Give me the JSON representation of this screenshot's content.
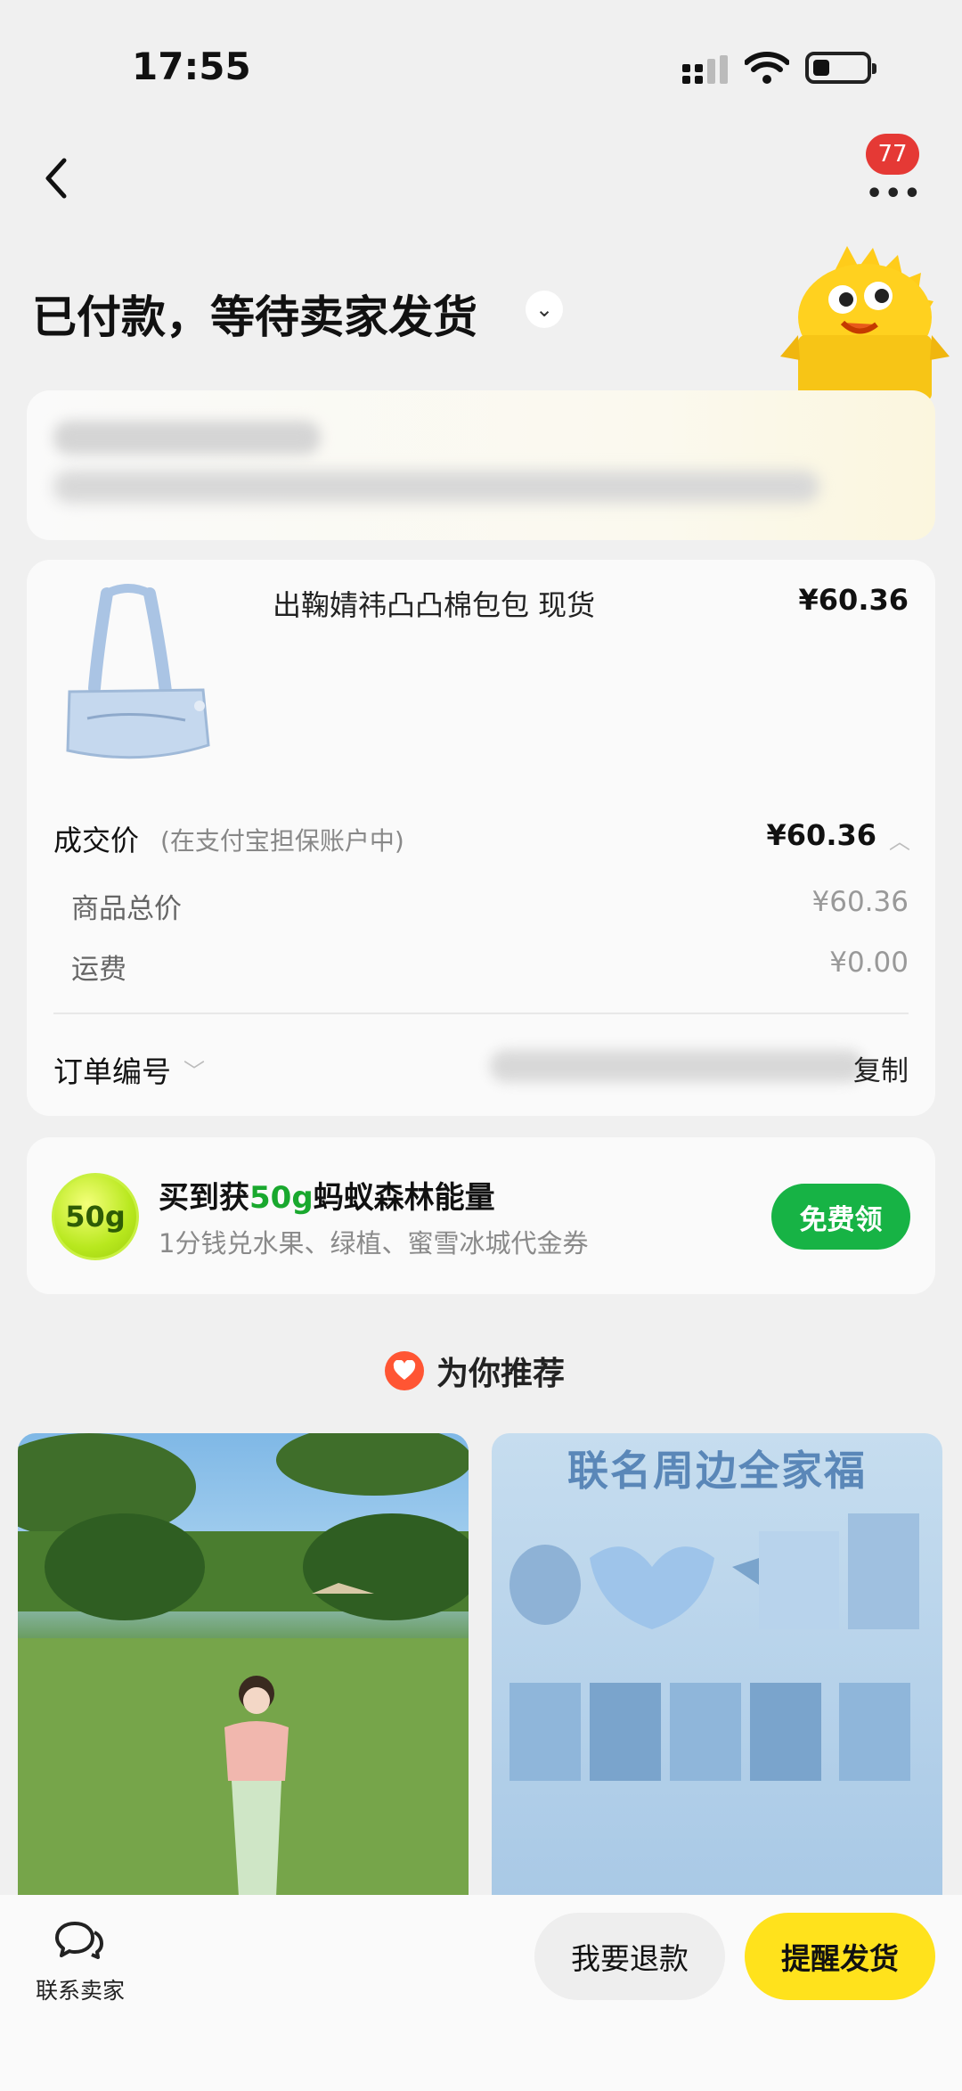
{
  "status_bar": {
    "time": "17:55"
  },
  "header": {
    "notification_count": "77",
    "title": "已付款，等待卖家发货"
  },
  "product": {
    "name": "出鞠婧祎凸凸棉包包 现货",
    "price": "¥60.36"
  },
  "price_detail": {
    "deal_label": "成交价",
    "deal_note": "(在支付宝担保账户中)",
    "deal_price": "¥60.36",
    "rows": [
      {
        "label": "商品总价",
        "value": "¥60.36"
      },
      {
        "label": "运费",
        "value": "¥0.00"
      }
    ]
  },
  "order_number": {
    "label": "订单编号",
    "copy_label": "复制"
  },
  "energy": {
    "badge": "50g",
    "title_prefix": "买到获",
    "title_amount": "50g",
    "title_suffix": "蚂蚁森林能量",
    "subtitle": "1分钱兑水果、绿植、蜜雪冰城代金券",
    "button": "免费领"
  },
  "recommend": {
    "title": "为你推荐",
    "card2_heading": "联名周边全家福"
  },
  "bottom_bar": {
    "contact_label": "联系卖家",
    "refund_button": "我要退款",
    "remind_button": "提醒发货"
  },
  "colors": {
    "accent_yellow": "#ffe21c",
    "energy_green": "#17b345",
    "badge_red": "#e53935"
  }
}
